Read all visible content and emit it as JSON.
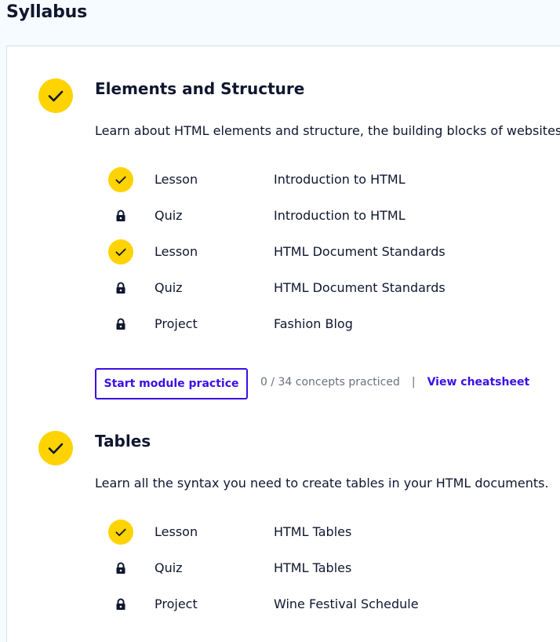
{
  "page": {
    "title": "Syllabus"
  },
  "colors": {
    "accent": "#3a10e5",
    "complete": "#ffd300",
    "text": "#10162f",
    "muted": "#6b6f80",
    "page_bg": "#f5fbff"
  },
  "modules": [
    {
      "title": "Elements and Structure",
      "status_icon": "check-icon",
      "description": "Learn about HTML elements and structure, the building blocks of websites.",
      "items": [
        {
          "type": "Lesson",
          "name": "Introduction to HTML",
          "status": "complete",
          "icon": "check-icon"
        },
        {
          "type": "Quiz",
          "name": "Introduction to HTML",
          "status": "locked",
          "icon": "lock-icon"
        },
        {
          "type": "Lesson",
          "name": "HTML Document Standards",
          "status": "complete",
          "icon": "check-icon"
        },
        {
          "type": "Quiz",
          "name": "HTML Document Standards",
          "status": "locked",
          "icon": "lock-icon"
        },
        {
          "type": "Project",
          "name": "Fashion Blog",
          "status": "locked",
          "icon": "lock-icon"
        }
      ],
      "practice": {
        "button_label": "Start module practice",
        "concepts_text": "0 / 34 concepts practiced",
        "separator": "|",
        "cheatsheet_label": "View cheatsheet"
      }
    },
    {
      "title": "Tables",
      "status_icon": "check-icon",
      "description": "Learn all the syntax you need to create tables in your HTML documents.",
      "items": [
        {
          "type": "Lesson",
          "name": "HTML Tables",
          "status": "complete",
          "icon": "check-icon"
        },
        {
          "type": "Quiz",
          "name": "HTML Tables",
          "status": "locked",
          "icon": "lock-icon"
        },
        {
          "type": "Project",
          "name": "Wine Festival Schedule",
          "status": "locked",
          "icon": "lock-icon"
        }
      ]
    }
  ]
}
